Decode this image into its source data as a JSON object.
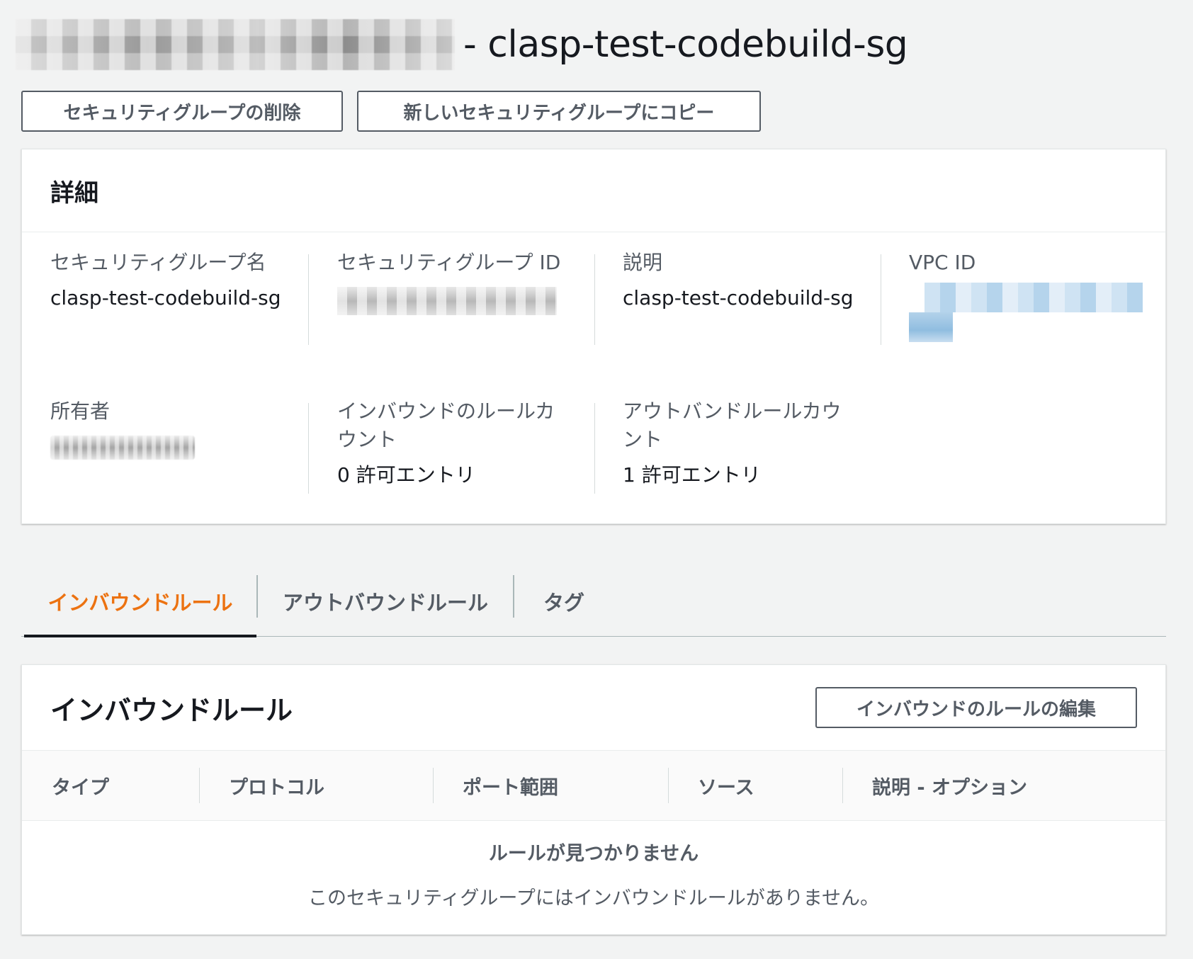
{
  "header": {
    "title_suffix": "- clasp-test-codebuild-sg"
  },
  "actions": {
    "delete_label": "セキュリティグループの削除",
    "copy_label": "新しいセキュリティグループにコピー"
  },
  "details": {
    "heading": "詳細",
    "sg_name_label": "セキュリティグループ名",
    "sg_name_value": "clasp-test-codebuild-sg",
    "sg_id_label": "セキュリティグループ ID",
    "description_label": "説明",
    "description_value": "clasp-test-codebuild-sg",
    "vpc_id_label": "VPC ID",
    "owner_label": "所有者",
    "inbound_count_label": "インバウンドのルールカウント",
    "inbound_count_value": "0 許可エントリ",
    "outbound_count_label": "アウトバンドルールカウント",
    "outbound_count_value": "1 許可エントリ"
  },
  "tabs": [
    {
      "label": "インバウンドルール",
      "active": true
    },
    {
      "label": "アウトバウンドルール",
      "active": false
    },
    {
      "label": "タグ",
      "active": false
    }
  ],
  "inbound": {
    "title": "インバウンドルール",
    "edit_label": "インバウンドのルールの編集",
    "columns": [
      "タイプ",
      "プロトコル",
      "ポート範囲",
      "ソース",
      "説明 - オプション"
    ],
    "empty_title": "ルールが見つかりません",
    "empty_sub": "このセキュリティグループにはインバウンドルールがありません。"
  },
  "colors": {
    "accent": "#ec7211",
    "text": "#16191f",
    "muted": "#545b64",
    "background": "#f2f3f3"
  }
}
